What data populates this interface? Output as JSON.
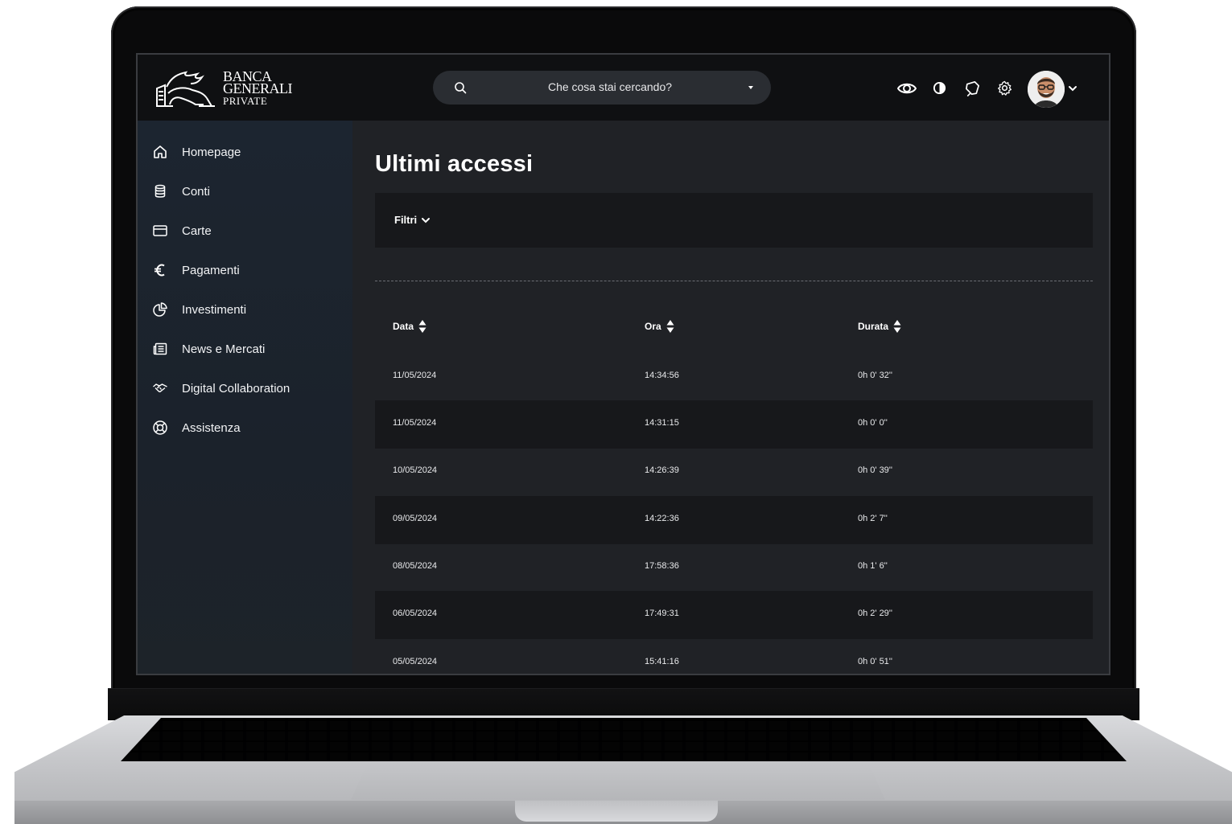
{
  "brand": {
    "line1": "BANCA",
    "line2": "GENERALI",
    "line3": "PRIVATE"
  },
  "search": {
    "placeholder": "Che cosa stai cercando?"
  },
  "topbar_icons": [
    "eye-icon",
    "contrast-icon",
    "notification-icon",
    "gear-icon",
    "avatar"
  ],
  "sidebar": {
    "items": [
      {
        "label": "Homepage",
        "icon": "home-icon"
      },
      {
        "label": "Conti",
        "icon": "coins-icon"
      },
      {
        "label": "Carte",
        "icon": "card-icon"
      },
      {
        "label": "Pagamenti",
        "icon": "euro-icon"
      },
      {
        "label": "Investimenti",
        "icon": "pie-chart-icon"
      },
      {
        "label": "News e Mercati",
        "icon": "newspaper-icon"
      },
      {
        "label": "Digital Collaboration",
        "icon": "handshake-icon"
      },
      {
        "label": "Assistenza",
        "icon": "lifebuoy-icon"
      }
    ]
  },
  "main": {
    "title": "Ultimi accessi",
    "filter_label": "Filtri",
    "columns": [
      "Data",
      "Ora",
      "Durata"
    ],
    "rows": [
      {
        "data": "11/05/2024",
        "ora": "14:34:56",
        "durata": "0h 0' 32''"
      },
      {
        "data": "11/05/2024",
        "ora": "14:31:15",
        "durata": "0h 0' 0''"
      },
      {
        "data": "10/05/2024",
        "ora": "14:26:39",
        "durata": "0h 0' 39''"
      },
      {
        "data": "09/05/2024",
        "ora": "14:22:36",
        "durata": "0h 2' 7''"
      },
      {
        "data": "08/05/2024",
        "ora": "17:58:36",
        "durata": "0h 1' 6''"
      },
      {
        "data": "06/05/2024",
        "ora": "17:49:31",
        "durata": "0h 2' 29''"
      },
      {
        "data": "05/05/2024",
        "ora": "15:41:16",
        "durata": "0h 0' 51''"
      }
    ]
  },
  "colors": {
    "topbar": "#0f1012",
    "sidebar": "#1c2530",
    "content": "#202226",
    "row_alt": "#17181b"
  }
}
